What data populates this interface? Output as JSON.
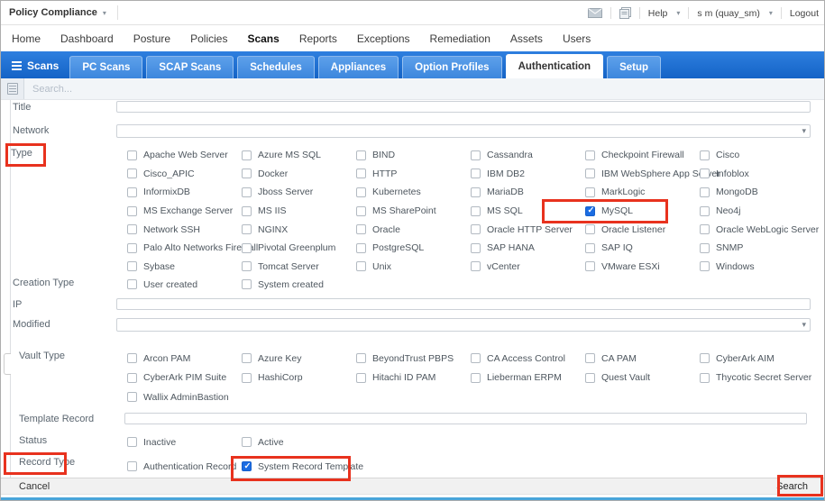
{
  "window": {
    "app_title": "Policy Compliance",
    "help_label": "Help",
    "user_label": "s m (quay_sm)",
    "logout_label": "Logout"
  },
  "menu": {
    "items": [
      "Home",
      "Dashboard",
      "Posture",
      "Policies",
      "Scans",
      "Reports",
      "Exceptions",
      "Remediation",
      "Assets",
      "Users"
    ],
    "active": "Scans"
  },
  "tabs": {
    "section_label": "Scans",
    "items": [
      "PC Scans",
      "SCAP Scans",
      "Schedules",
      "Appliances",
      "Option Profiles",
      "Authentication",
      "Setup"
    ],
    "active": "Authentication"
  },
  "search": {
    "placeholder": "Search..."
  },
  "form": {
    "title": {
      "label": "Title",
      "value": ""
    },
    "network": {
      "label": "Network",
      "value": ""
    },
    "type": {
      "label": "Type",
      "options": [
        {
          "label": "Apache Web Server",
          "checked": false
        },
        {
          "label": "Azure MS SQL",
          "checked": false
        },
        {
          "label": "BIND",
          "checked": false
        },
        {
          "label": "Cassandra",
          "checked": false
        },
        {
          "label": "Checkpoint Firewall",
          "checked": false
        },
        {
          "label": "Cisco",
          "checked": false
        },
        {
          "label": "Cisco_APIC",
          "checked": false
        },
        {
          "label": "Docker",
          "checked": false
        },
        {
          "label": "HTTP",
          "checked": false
        },
        {
          "label": "IBM DB2",
          "checked": false
        },
        {
          "label": "IBM WebSphere App Server",
          "checked": false
        },
        {
          "label": "Infoblox",
          "checked": false
        },
        {
          "label": "InformixDB",
          "checked": false
        },
        {
          "label": "Jboss Server",
          "checked": false
        },
        {
          "label": "Kubernetes",
          "checked": false
        },
        {
          "label": "MariaDB",
          "checked": false
        },
        {
          "label": "MarkLogic",
          "checked": false
        },
        {
          "label": "MongoDB",
          "checked": false
        },
        {
          "label": "MS Exchange Server",
          "checked": false
        },
        {
          "label": "MS IIS",
          "checked": false
        },
        {
          "label": "MS SharePoint",
          "checked": false
        },
        {
          "label": "MS SQL",
          "checked": false
        },
        {
          "label": "MySQL",
          "checked": true
        },
        {
          "label": "Neo4j",
          "checked": false
        },
        {
          "label": "Network SSH",
          "checked": false
        },
        {
          "label": "NGINX",
          "checked": false
        },
        {
          "label": "Oracle",
          "checked": false
        },
        {
          "label": "Oracle HTTP Server",
          "checked": false
        },
        {
          "label": "Oracle Listener",
          "checked": false
        },
        {
          "label": "Oracle WebLogic Server",
          "checked": false
        },
        {
          "label": "Palo Alto Networks Firewall",
          "checked": false
        },
        {
          "label": "Pivotal Greenplum",
          "checked": false
        },
        {
          "label": "PostgreSQL",
          "checked": false
        },
        {
          "label": "SAP HANA",
          "checked": false
        },
        {
          "label": "SAP IQ",
          "checked": false
        },
        {
          "label": "SNMP",
          "checked": false
        },
        {
          "label": "Sybase",
          "checked": false
        },
        {
          "label": "Tomcat Server",
          "checked": false
        },
        {
          "label": "Unix",
          "checked": false
        },
        {
          "label": "vCenter",
          "checked": false
        },
        {
          "label": "VMware ESXi",
          "checked": false
        },
        {
          "label": "Windows",
          "checked": false
        }
      ]
    },
    "creation_type": {
      "label": "Creation Type",
      "options": [
        {
          "label": "User created",
          "checked": false
        },
        {
          "label": "System created",
          "checked": false
        }
      ]
    },
    "ip": {
      "label": "IP",
      "value": ""
    },
    "modified": {
      "label": "Modified",
      "value": ""
    },
    "vault_type": {
      "label": "Vault Type",
      "options": [
        {
          "label": "Arcon PAM",
          "checked": false
        },
        {
          "label": "Azure Key",
          "checked": false
        },
        {
          "label": "BeyondTrust PBPS",
          "checked": false
        },
        {
          "label": "CA Access Control",
          "checked": false
        },
        {
          "label": "CA PAM",
          "checked": false
        },
        {
          "label": "CyberArk AIM",
          "checked": false
        },
        {
          "label": "CyberArk PIM Suite",
          "checked": false
        },
        {
          "label": "HashiCorp",
          "checked": false
        },
        {
          "label": "Hitachi ID PAM",
          "checked": false
        },
        {
          "label": "Lieberman ERPM",
          "checked": false
        },
        {
          "label": "Quest Vault",
          "checked": false
        },
        {
          "label": "Thycotic Secret Server",
          "checked": false
        },
        {
          "label": "Wallix AdminBastion",
          "checked": false
        }
      ]
    },
    "template_record": {
      "label": "Template Record",
      "value": ""
    },
    "status": {
      "label": "Status",
      "options": [
        {
          "label": "Inactive",
          "checked": false
        },
        {
          "label": "Active",
          "checked": false
        }
      ]
    },
    "record_type": {
      "label": "Record Type",
      "options": [
        {
          "label": "Authentication Record",
          "checked": false
        },
        {
          "label": "System Record Template",
          "checked": true
        }
      ]
    }
  },
  "footer": {
    "cancel_label": "Cancel",
    "search_label": "Search"
  },
  "colors": {
    "tabbar_blue": "#1463c6",
    "tab_inactive_blue": "#3c86dd",
    "checked_checkbox_blue": "#1b6ce2",
    "annotation_red": "#e8321e"
  }
}
